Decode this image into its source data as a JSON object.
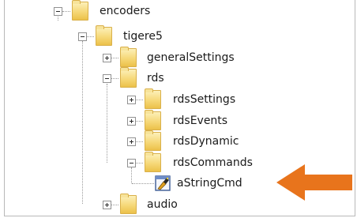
{
  "tree": {
    "items": [
      {
        "label": "encoders",
        "icon": "folder-icon",
        "expander": "minus"
      },
      {
        "label": "tigere5",
        "icon": "folder-icon",
        "expander": "minus"
      },
      {
        "label": "generalSettings",
        "icon": "folder-icon",
        "expander": "plus"
      },
      {
        "label": "rds",
        "icon": "folder-icon",
        "expander": "minus"
      },
      {
        "label": "rdsSettings",
        "icon": "folder-icon",
        "expander": "plus"
      },
      {
        "label": "rdsEvents",
        "icon": "folder-icon",
        "expander": "plus"
      },
      {
        "label": "rdsDynamic",
        "icon": "folder-icon",
        "expander": "plus"
      },
      {
        "label": "rdsCommands",
        "icon": "folder-icon",
        "expander": "minus"
      },
      {
        "label": "aStringCmd",
        "icon": "command-item-icon",
        "expander": "none"
      },
      {
        "label": "audio",
        "icon": "folder-icon",
        "expander": "plus"
      }
    ]
  },
  "annotation": {
    "icon": "arrow-left-icon",
    "color": "#e8741c"
  }
}
